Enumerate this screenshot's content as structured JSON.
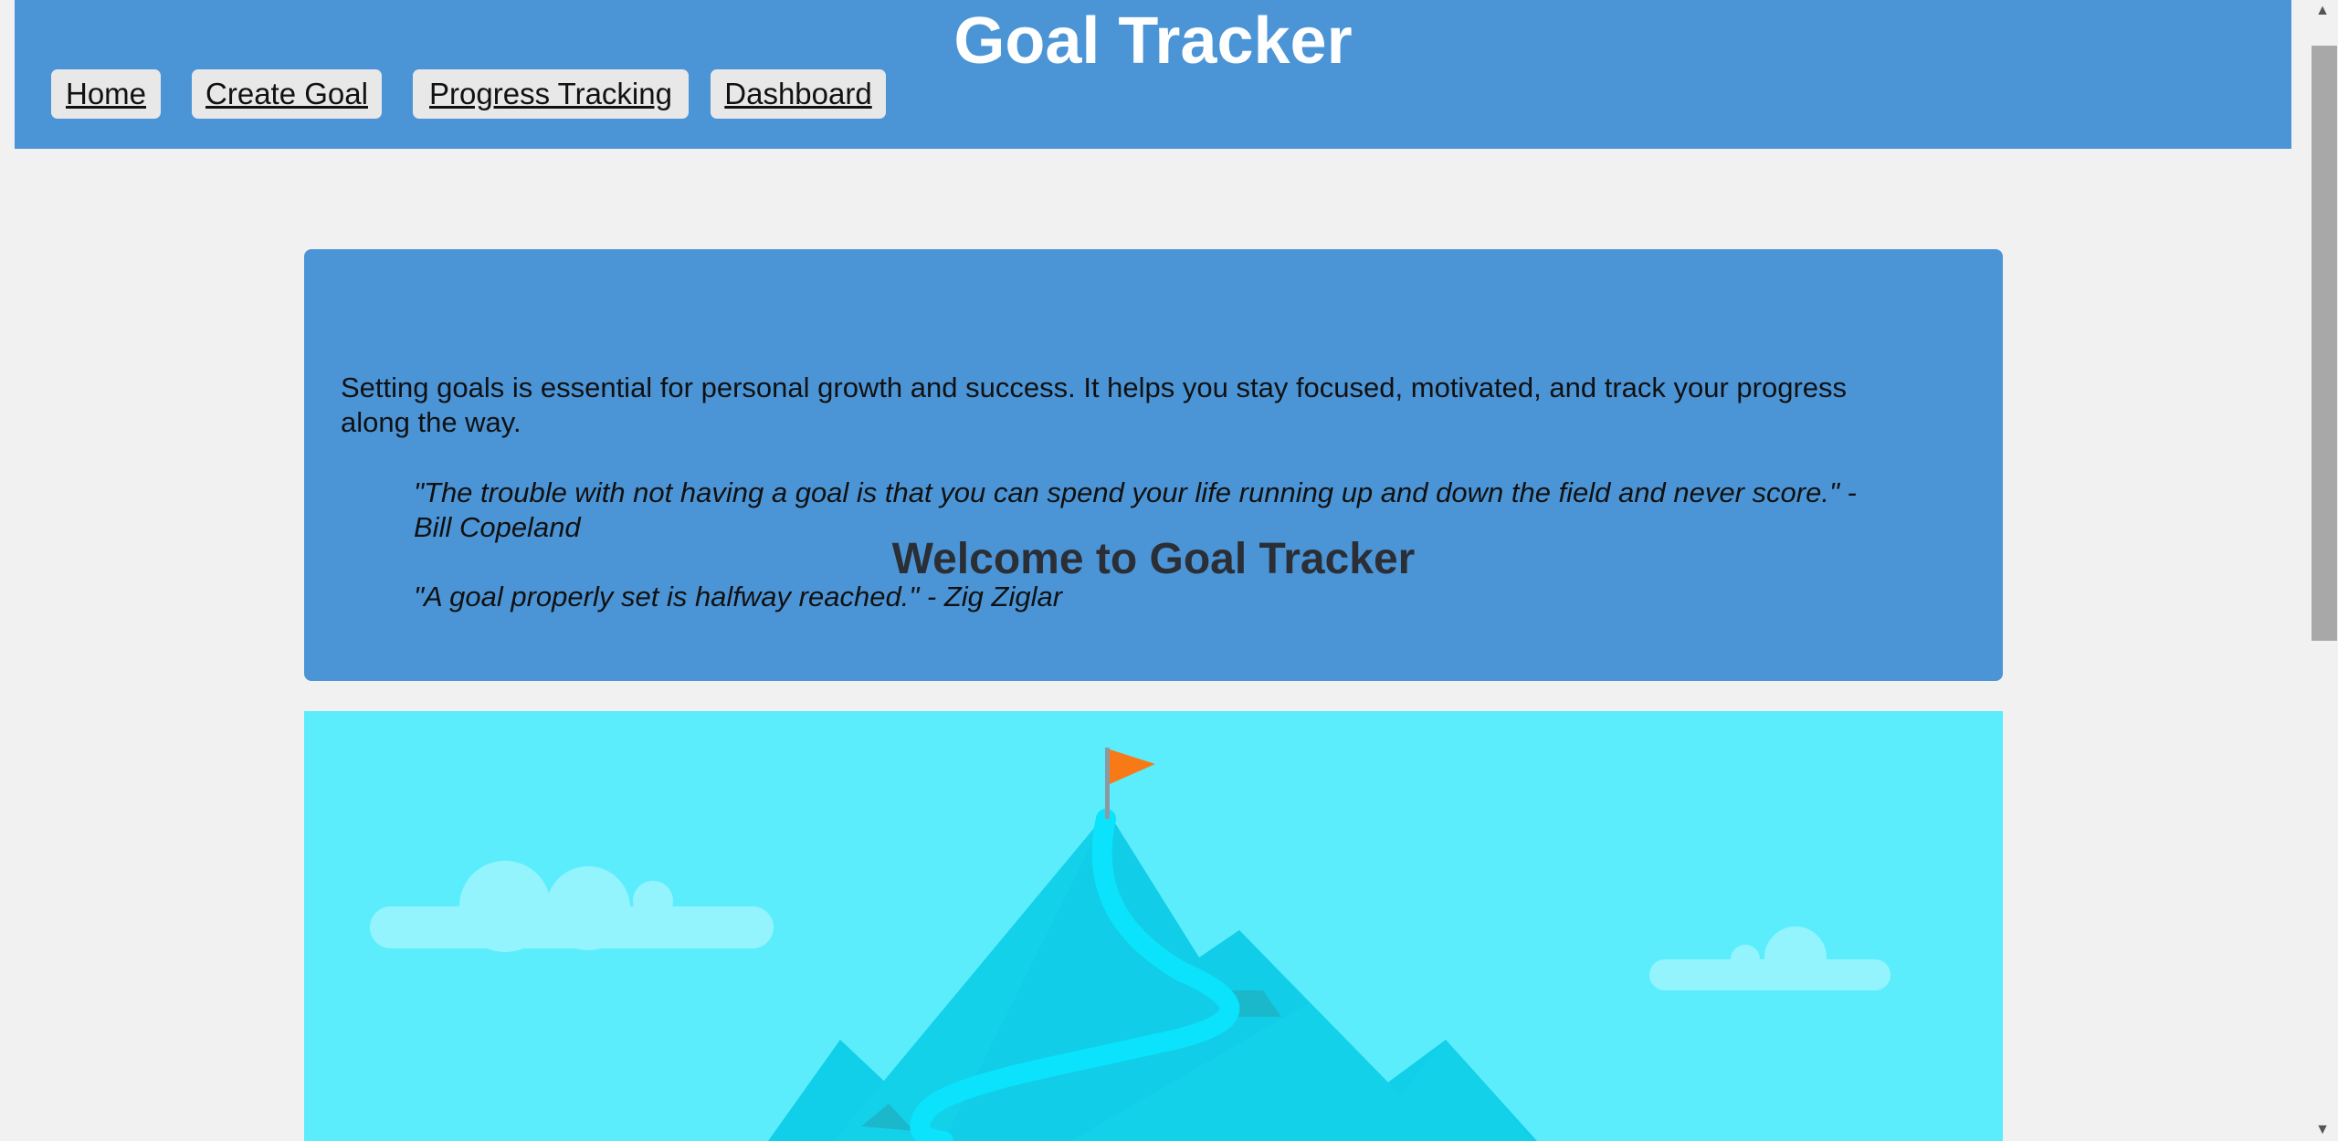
{
  "header": {
    "title": "Goal Tracker",
    "nav": [
      "Home",
      "Create Goal",
      "Progress Tracking",
      "Dashboard"
    ]
  },
  "welcome": {
    "title": "Welcome to Goal Tracker",
    "intro": "Setting goals is essential for personal growth and success. It helps you stay focused, motivated, and track your progress along the way.",
    "quotes": [
      "\"The trouble with not having a goal is that you can spend your life running up and down the field and never score.\" - Bill Copeland",
      "\"A goal properly set is halfway reached.\" - Zig Ziglar"
    ]
  },
  "colors": {
    "header_bg": "#4b95d7",
    "page_bg": "#f1f1f2",
    "sky": "#5cedfd",
    "mountain": "#12cfe9",
    "path": "#0ae3fb",
    "flag": "#f77a17"
  },
  "icons": [
    "flag-icon",
    "mountain-illustration",
    "cloud-icon"
  ]
}
